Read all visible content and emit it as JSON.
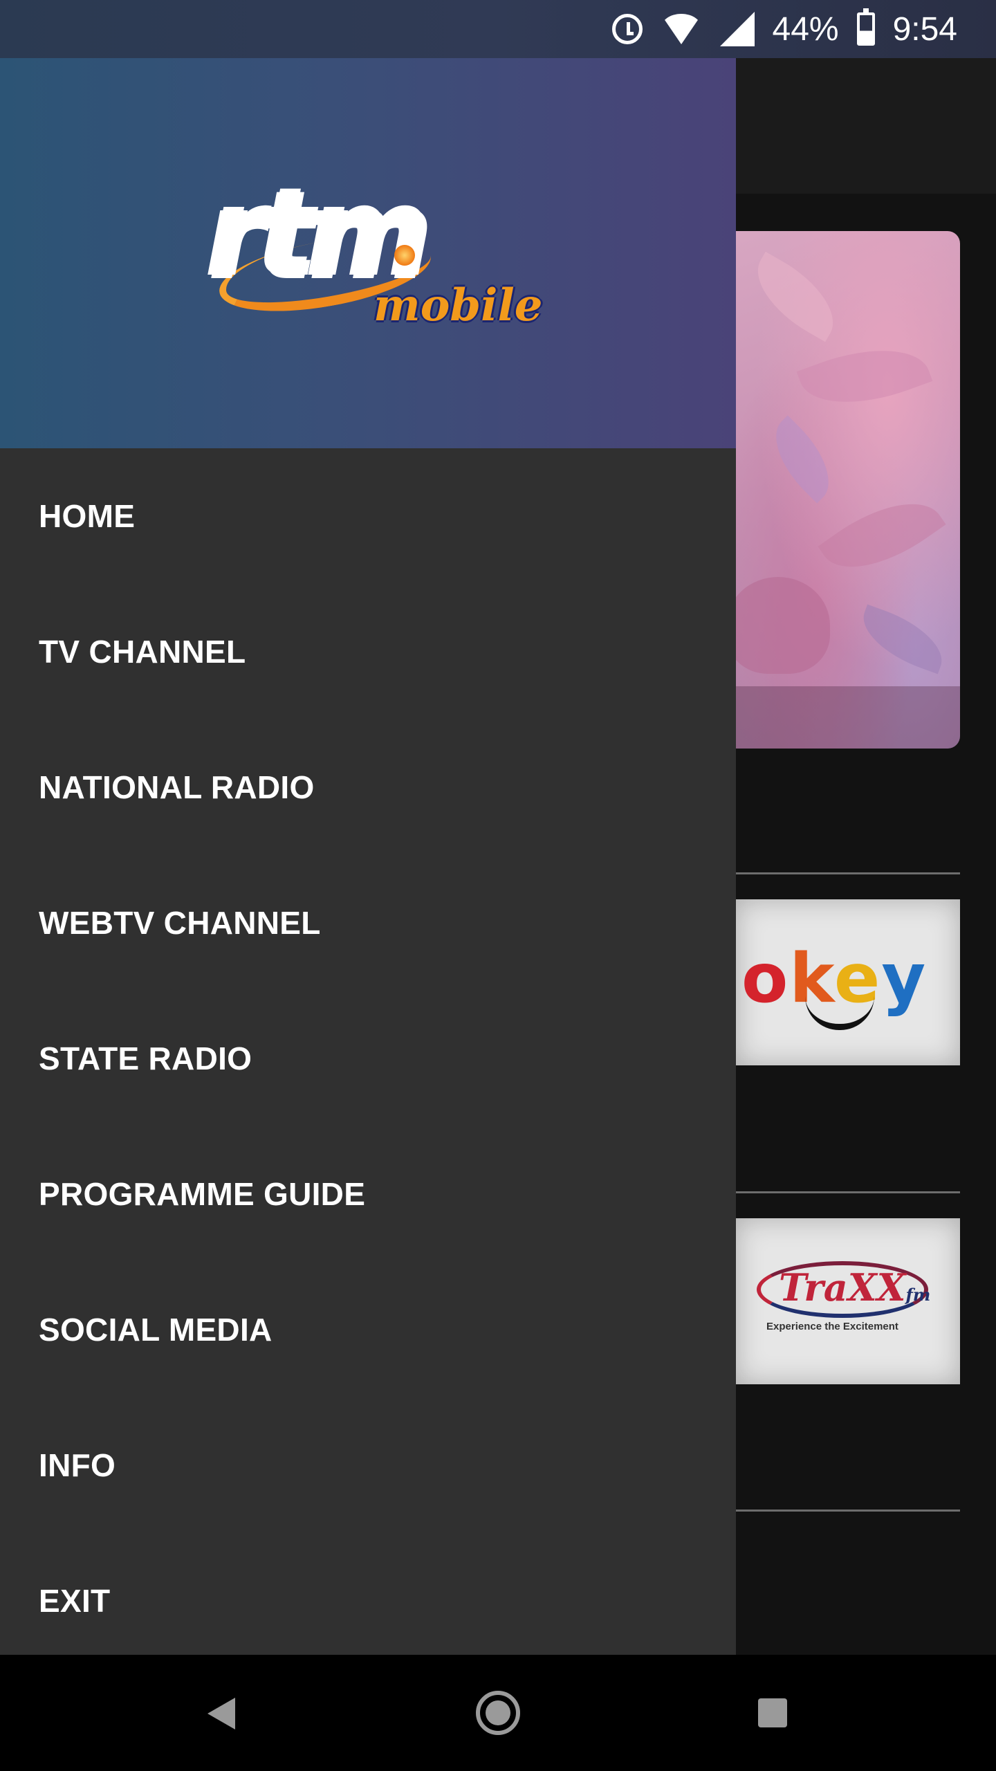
{
  "status_bar": {
    "battery": "44%",
    "time": "9:54",
    "icons": [
      "alarm-icon",
      "wifi-icon",
      "signal-icon",
      "battery-icon"
    ]
  },
  "drawer": {
    "logo": {
      "main": "rtm",
      "sub": "mobile"
    },
    "menu": [
      {
        "label": "HOME"
      },
      {
        "label": "TV CHANNEL"
      },
      {
        "label": "NATIONAL RADIO"
      },
      {
        "label": "WEBTV CHANNEL"
      },
      {
        "label": "STATE RADIO"
      },
      {
        "label": "PROGRAMME GUIDE"
      },
      {
        "label": "SOCIAL MEDIA"
      },
      {
        "label": "INFO"
      },
      {
        "label": "EXIT"
      }
    ]
  },
  "background": {
    "okey_logo": "okey",
    "traxx_logo": "TraXX",
    "traxx_sub": "fm",
    "traxx_tagline": "Experience the Excitement"
  },
  "nav_bar": {
    "icons": [
      "back-icon",
      "home-icon",
      "recents-icon"
    ]
  },
  "colors": {
    "drawer_bg": "#303030",
    "header_start": "#2c5475",
    "header_end": "#4a4378",
    "menu_text": "#ffffff"
  }
}
